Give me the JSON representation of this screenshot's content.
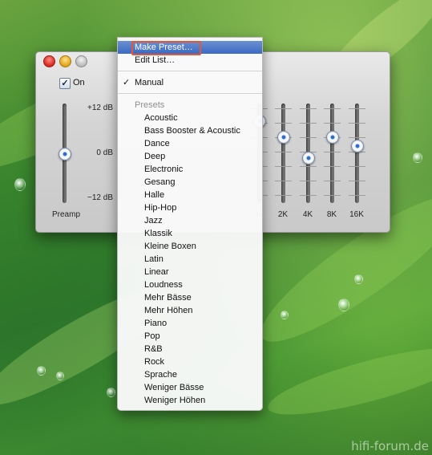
{
  "eq_window": {
    "enable_checked": true,
    "enable_label": "On",
    "db_labels": {
      "top": "+12 dB",
      "middle": "0 dB",
      "bottom": "−12 dB"
    },
    "preamp_label": "Preamp",
    "preamp_level_db": 0,
    "bands": [
      {
        "label": "K",
        "level_db": 8
      },
      {
        "label": "2K",
        "level_db": 4
      },
      {
        "label": "4K",
        "level_db": -1
      },
      {
        "label": "8K",
        "level_db": 4
      },
      {
        "label": "16K",
        "level_db": 2
      }
    ]
  },
  "menu": {
    "make_preset_label": "Make Preset…",
    "edit_list_label": "Edit List…",
    "manual_label": "Manual",
    "manual_checked": true,
    "presets_header": "Presets",
    "presets": [
      "Acoustic",
      "Bass Booster & Acoustic",
      "Dance",
      "Deep",
      "Electronic",
      "Gesang",
      "Halle",
      "Hip-Hop",
      "Jazz",
      "Klassik",
      "Kleine Boxen",
      "Latin",
      "Linear",
      "Loudness",
      "Mehr Bässe",
      "Mehr Höhen",
      "Piano",
      "Pop",
      "R&B",
      "Rock",
      "Sprache",
      "Weniger Bässe",
      "Weniger Höhen"
    ]
  },
  "watermark": "hifi-forum.de",
  "colors": {
    "menu_highlight": "#3b6ac3",
    "annotation_box": "#e05a3a",
    "close_button": "#d5251c",
    "minimize_button": "#e0a115"
  }
}
